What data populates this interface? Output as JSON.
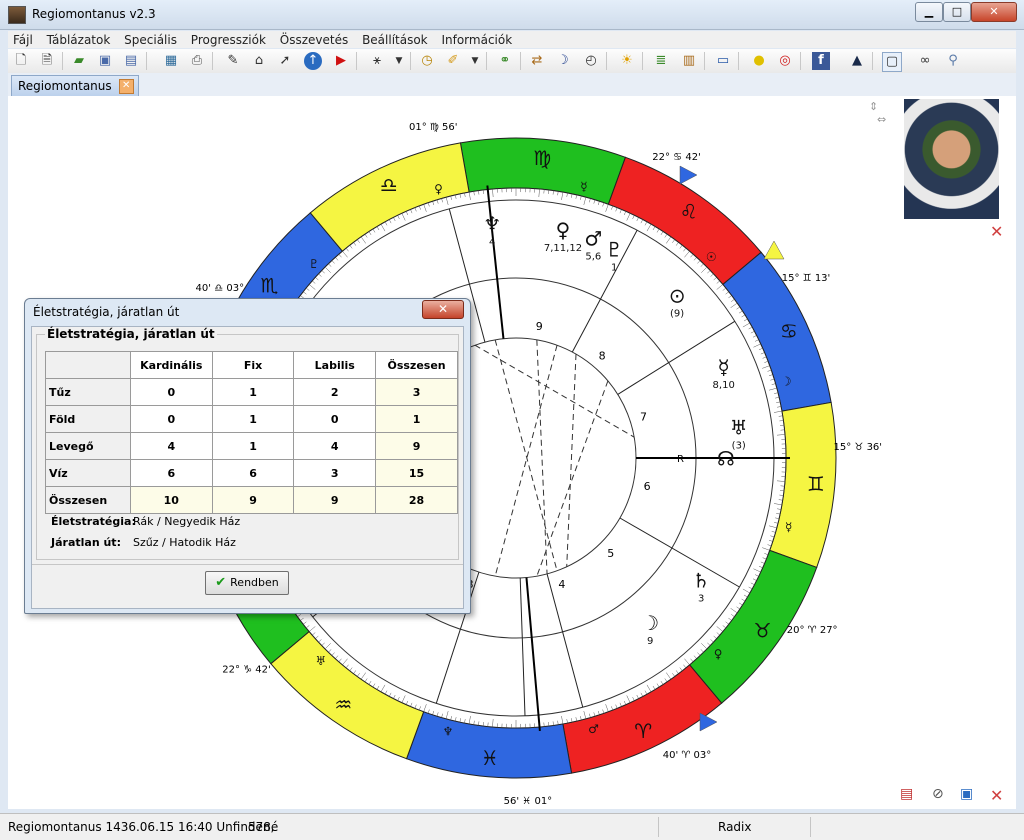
{
  "window": {
    "title": "Regiomontanus v2.3",
    "minimize": "▁",
    "maximize": "□",
    "close": "✕"
  },
  "menu": [
    "Fájl",
    "Táblázatok",
    "Speciális",
    "Progressziók",
    "Összevetés",
    "Beállítások",
    "Információk"
  ],
  "toolbar_icons": [
    "new-file-icon",
    "new-doc-icon",
    "open-folder-icon",
    "save-icon",
    "save-all-icon",
    "picture-icon",
    "print-icon",
    "tools-icon",
    "home-icon",
    "pointer-icon",
    "up-icon",
    "flag-icon",
    "aspect-icon",
    "dropdown-icon",
    "clock-icon",
    "paint-icon",
    "dropdown-icon",
    "chain-icon",
    "direction-icon",
    "moon-icon",
    "timer-icon",
    "sun-icon",
    "layers-icon",
    "books-icon",
    "monitor-icon",
    "bulb-icon",
    "lifebuoy-icon",
    "facebook-icon",
    "graduate-icon",
    "comment-icon",
    "glasses-icon",
    "magnifier-icon"
  ],
  "tab": {
    "label": "Regiomontanus"
  },
  "chart": {
    "signs": [
      {
        "symbol": "♍",
        "color": "#1fbf1f",
        "ruler": "☿"
      },
      {
        "symbol": "♌",
        "color": "#ee2222",
        "ruler": "☉"
      },
      {
        "symbol": "♋",
        "color": "#2f67e0",
        "ruler": "☽"
      },
      {
        "symbol": "♊",
        "color": "#f5f542",
        "ruler": "☿"
      },
      {
        "symbol": "♉",
        "color": "#1fbf1f",
        "ruler": "♀"
      },
      {
        "symbol": "♈",
        "color": "#ee2222",
        "ruler": "♂"
      },
      {
        "symbol": "♓",
        "color": "#2f67e0",
        "ruler": "♆"
      },
      {
        "symbol": "♒",
        "color": "#f5f542",
        "ruler": "♅"
      },
      {
        "symbol": "♑",
        "color": "#1fbf1f",
        "ruler": "♄"
      },
      {
        "symbol": "♐",
        "color": "#ee2222",
        "ruler": "♃"
      },
      {
        "symbol": "♏",
        "color": "#2f67e0",
        "ruler": "♇"
      },
      {
        "symbol": "♎",
        "color": "#f5f542",
        "ruler": "♀"
      }
    ],
    "cusps": [
      {
        "deg": "01°",
        "sym": "♍",
        "min": "56'"
      },
      {
        "deg": "22°",
        "sym": "♋",
        "min": "42'"
      },
      {
        "deg": "15°",
        "sym": "♊",
        "min": "13'"
      },
      {
        "deg": "15°",
        "sym": "♉",
        "min": "36'"
      },
      {
        "deg": "20°",
        "sym": "♈",
        "min": "27°"
      },
      {
        "deg": "40'",
        "sym": "♈",
        "min": "03°"
      },
      {
        "deg": "56'",
        "sym": "♓",
        "min": "01°"
      },
      {
        "deg": "22°",
        "sym": "♑",
        "min": "42'"
      },
      {
        "deg": "40'",
        "sym": "♎",
        "min": "03°"
      }
    ],
    "planets": [
      {
        "sym": "♆",
        "label": "4"
      },
      {
        "sym": "♀",
        "label": "7,11,12"
      },
      {
        "sym": "♂",
        "label": "5,6"
      },
      {
        "sym": "♇",
        "label": "1"
      },
      {
        "sym": "⊙",
        "label": "(9)"
      },
      {
        "sym": "☿",
        "label": "8,10"
      },
      {
        "sym": "♅",
        "label": "(3)"
      },
      {
        "sym": "☊",
        "label": ""
      },
      {
        "sym": "♄",
        "label": "3"
      },
      {
        "sym": "☽",
        "label": "9"
      }
    ],
    "houses": [
      "9",
      "8",
      "7",
      "6",
      "5",
      "4",
      "3"
    ],
    "mc_label": "R"
  },
  "dialog": {
    "title": "Életstratégia, járatlan út",
    "close": "✕",
    "group_label": "Életstratégia, járatlan út",
    "columns": [
      "",
      "Kardinális",
      "Fix",
      "Labilis",
      "Összesen"
    ],
    "rows": [
      {
        "label": "Tűz",
        "values": [
          "0",
          "1",
          "2",
          "3"
        ]
      },
      {
        "label": "Föld",
        "values": [
          "0",
          "1",
          "0",
          "1"
        ]
      },
      {
        "label": "Levegő",
        "values": [
          "4",
          "1",
          "4",
          "9"
        ]
      },
      {
        "label": "Víz",
        "values": [
          "6",
          "6",
          "3",
          "15"
        ]
      },
      {
        "label": "Összesen",
        "values": [
          "10",
          "9",
          "9",
          "28"
        ]
      }
    ],
    "strategy_label": "Életstratégia:",
    "strategy_value": "Rák / Negyedik Ház",
    "path_label": "Járatlan út:",
    "path_value": "Szűz / Hatodik Ház",
    "ok_label": "Rendben"
  },
  "status": {
    "info": "Regiomontanus 1436.06.15 16:40 Unfinden,",
    "age": "578é",
    "mode": "Radix"
  }
}
